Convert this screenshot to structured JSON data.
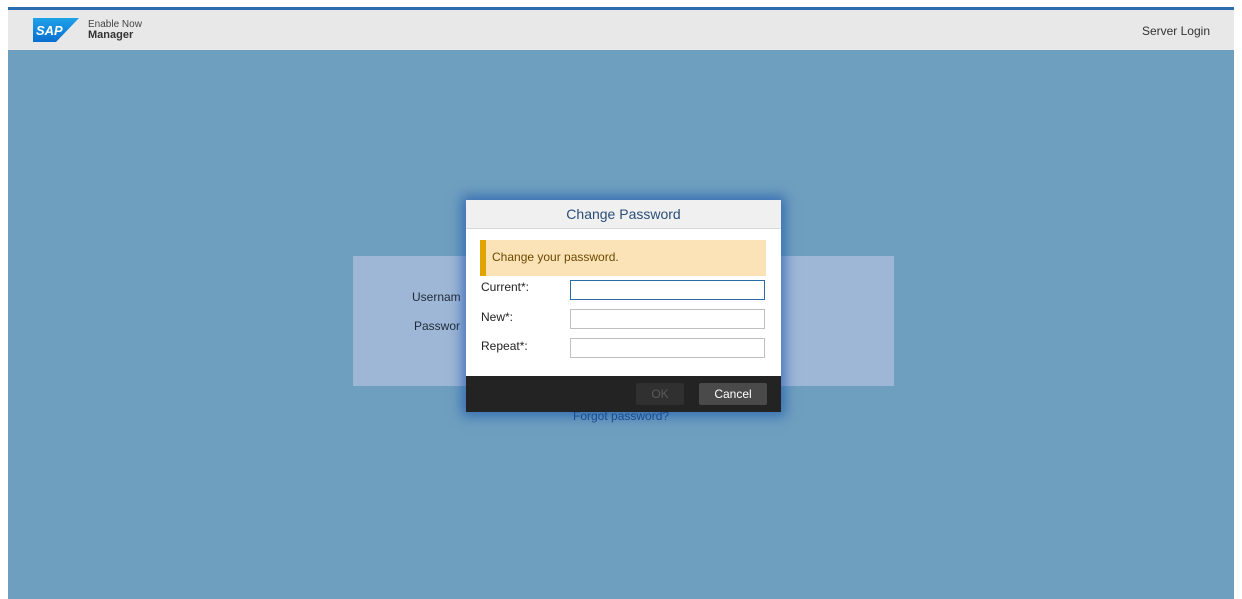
{
  "header": {
    "brand_logo_text": "SAP",
    "brand_line1": "Enable Now",
    "brand_line2": "Manager",
    "server_login": "Server Login"
  },
  "login_form": {
    "username_label": "Usernam",
    "password_label": "Passwor",
    "forgot_password": "Forgot password?"
  },
  "dialog": {
    "title": "Change Password",
    "message": "Change your password.",
    "fields": [
      {
        "label": "Current*:",
        "value": "",
        "focused": true
      },
      {
        "label": "New*:",
        "value": ""
      },
      {
        "label": "Repeat*:",
        "value": ""
      }
    ],
    "ok_label": "OK",
    "cancel_label": "Cancel"
  },
  "colors": {
    "background": "#6f9fbf",
    "accent": "#2b6cb0",
    "warning_border": "#e0a300",
    "warning_bg": "#fbe3b7"
  }
}
